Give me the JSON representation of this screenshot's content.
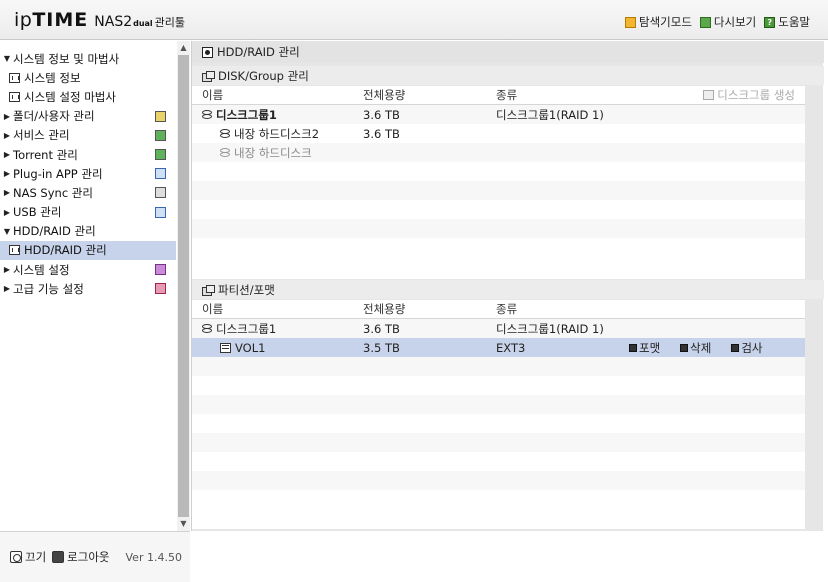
{
  "header": {
    "brand_ip": "ip",
    "brand_time": "TIME",
    "brand_nas": "NAS2",
    "brand_dual": "dual",
    "brand_admin": "관리툴",
    "links": [
      {
        "label": "탐색기모드",
        "icon": "explorer-mode-icon",
        "color": "#f2b632"
      },
      {
        "label": "다시보기",
        "icon": "refresh-icon",
        "color": "#5aa84a"
      },
      {
        "label": "도움말",
        "icon": "help-icon",
        "color": "#4a9a3a"
      }
    ]
  },
  "sidebar": {
    "items": [
      {
        "label": "시스템 정보 및 마법사",
        "arrow": "▼"
      },
      {
        "label": "시스템 정보"
      },
      {
        "label": "시스템 설정 마법사"
      },
      {
        "label": "폴더/사용자 관리",
        "arrow": "▶"
      },
      {
        "label": "서비스 관리",
        "arrow": "▶"
      },
      {
        "label": "Torrent 관리",
        "arrow": "▶"
      },
      {
        "label": "Plug-in APP 관리",
        "arrow": "▶"
      },
      {
        "label": "NAS Sync 관리",
        "arrow": "▶"
      },
      {
        "label": "USB 관리",
        "arrow": "▶"
      },
      {
        "label": "HDD/RAID 관리",
        "arrow": "▼"
      },
      {
        "label": "HDD/RAID 관리"
      },
      {
        "label": "시스템 설정",
        "arrow": "▶"
      },
      {
        "label": "고급 기능 설정",
        "arrow": "▶"
      }
    ],
    "scroll_up": "▲",
    "scroll_down": "▼"
  },
  "footer": {
    "power_label": "끄기",
    "logout_label": "로그아웃",
    "version": "Ver 1.4.50"
  },
  "main": {
    "title": "HDD/RAID 관리",
    "disk_section": {
      "title": "DISK/Group 관리",
      "headers": [
        "이름",
        "전체용량",
        "종류"
      ],
      "create_label": "디스크그룹 생성",
      "rows": [
        {
          "name": "디스크그룹1",
          "size": "3.6 TB",
          "type": "디스크그룹1(RAID 1)"
        },
        {
          "name": "내장 하드디스크2",
          "size": "3.6 TB",
          "type": ""
        },
        {
          "name": "내장 하드디스크",
          "size": "",
          "type": ""
        }
      ]
    },
    "partition_section": {
      "title": "파티션/포맷",
      "headers": [
        "이름",
        "전체용량",
        "종류"
      ],
      "rows": [
        {
          "name": "디스크그룹1",
          "size": "3.6 TB",
          "type": "디스크그룹1(RAID 1)"
        },
        {
          "name": "VOL1",
          "size": "3.5 TB",
          "type": "EXT3"
        }
      ],
      "actions": [
        "포맷",
        "삭제",
        "검사"
      ]
    }
  }
}
